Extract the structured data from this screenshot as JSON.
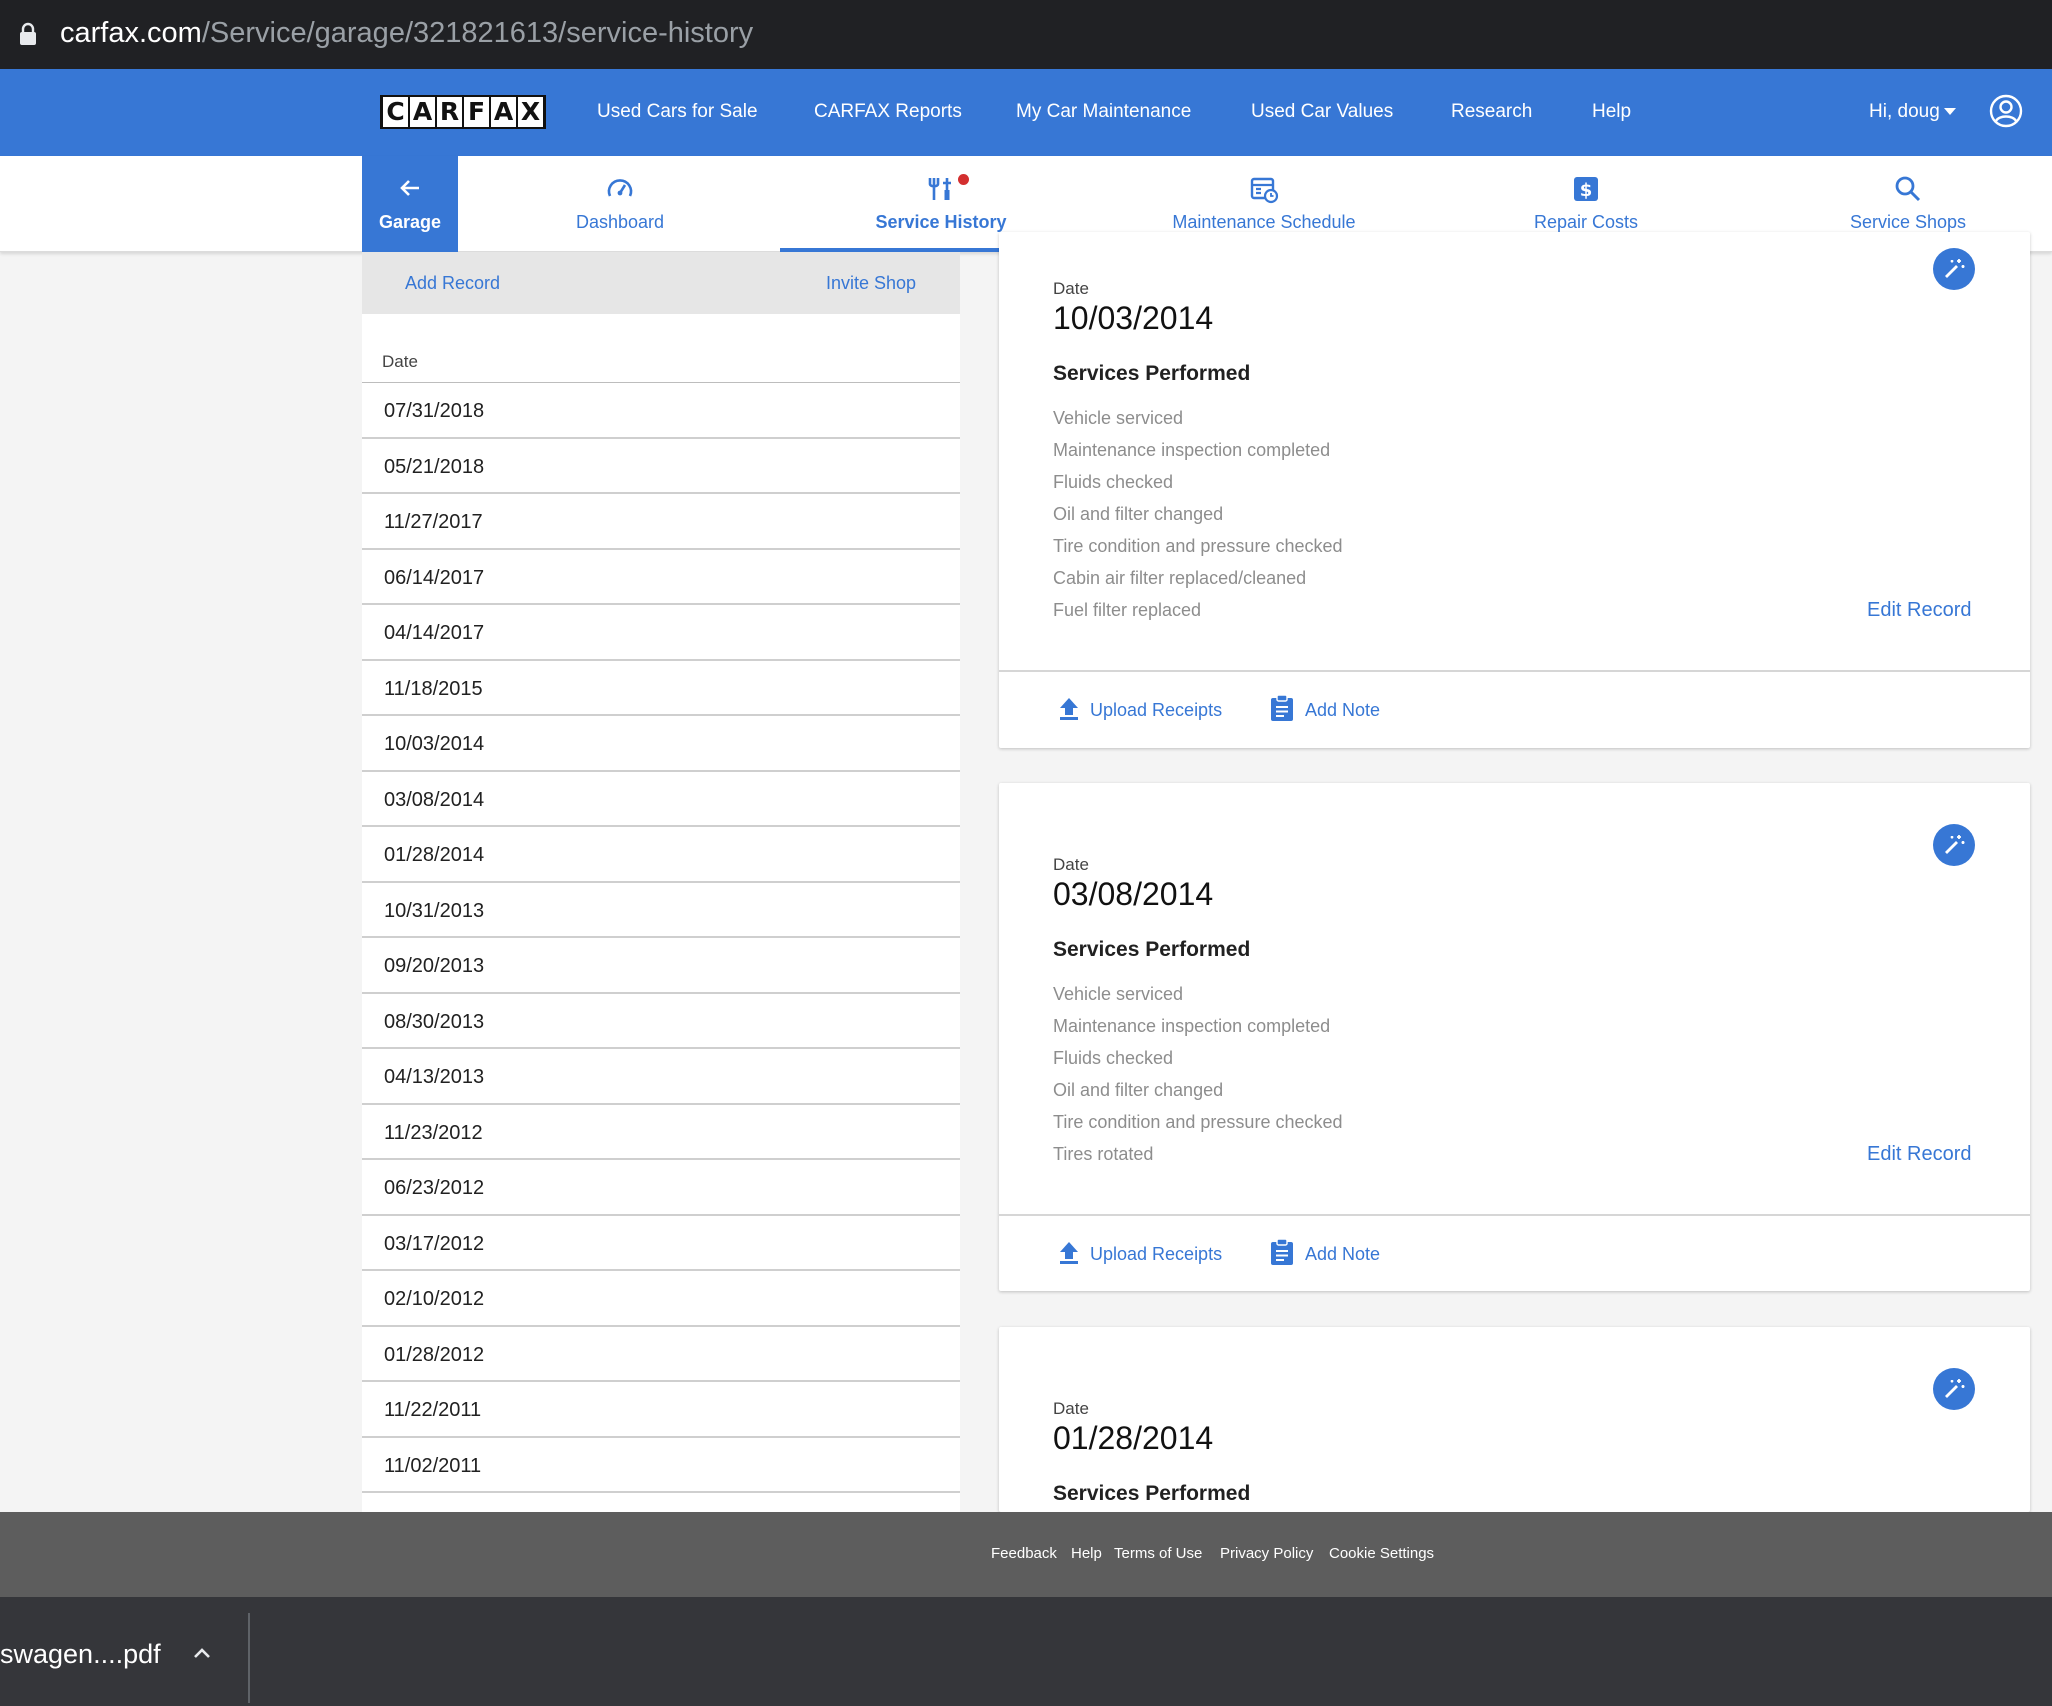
{
  "browser": {
    "url_host": "carfax.com",
    "url_path": "/Service/garage/321821613/service-history"
  },
  "topnav": {
    "logo_letters": [
      "C",
      "A",
      "R",
      "F",
      "A",
      "X"
    ],
    "links": [
      "Used Cars for Sale",
      "CARFAX Reports",
      "My Car Maintenance",
      "Used Car Values",
      "Research",
      "Help"
    ],
    "user_greeting": "Hi, doug"
  },
  "subnav": {
    "garage_label": "Garage",
    "tabs": [
      "Dashboard",
      "Service History",
      "Maintenance Schedule",
      "Repair Costs",
      "Service Shops"
    ],
    "active_tab": "Service History"
  },
  "list": {
    "add_record": "Add Record",
    "invite_shop": "Invite Shop",
    "date_header": "Date",
    "dates": [
      "07/31/2018",
      "05/21/2018",
      "11/27/2017",
      "06/14/2017",
      "04/14/2017",
      "11/18/2015",
      "10/03/2014",
      "03/08/2014",
      "01/28/2014",
      "10/31/2013",
      "09/20/2013",
      "08/30/2013",
      "04/13/2013",
      "11/23/2012",
      "06/23/2012",
      "03/17/2012",
      "02/10/2012",
      "01/28/2012",
      "11/22/2011",
      "11/02/2011"
    ]
  },
  "records": [
    {
      "date_label": "Date",
      "date": "10/03/2014",
      "services_title": "Services Performed",
      "services": [
        "Vehicle serviced",
        "Maintenance inspection completed",
        "Fluids checked",
        "Oil and filter changed",
        "Tire condition and pressure checked",
        "Cabin air filter replaced/cleaned",
        "Fuel filter replaced"
      ],
      "edit_label": "Edit Record",
      "upload_label": "Upload Receipts",
      "note_label": "Add Note"
    },
    {
      "date_label": "Date",
      "date": "03/08/2014",
      "services_title": "Services Performed",
      "services": [
        "Vehicle serviced",
        "Maintenance inspection completed",
        "Fluids checked",
        "Oil and filter changed",
        "Tire condition and pressure checked",
        "Tires rotated"
      ],
      "edit_label": "Edit Record",
      "upload_label": "Upload Receipts",
      "note_label": "Add Note"
    },
    {
      "date_label": "Date",
      "date": "01/28/2014",
      "services_title": "Services Performed"
    }
  ],
  "footer": {
    "links": [
      "Feedback",
      "Help",
      "Terms of Use",
      "Privacy Policy",
      "Cookie Settings"
    ]
  },
  "download": {
    "file_name": "swagen....pdf"
  },
  "colors": {
    "brand_blue": "#3777d5",
    "footer_gray": "#5d5d5d",
    "notification_red": "#d32f2f"
  },
  "icons": [
    "lock-icon",
    "arrow-left-icon",
    "speedometer-icon",
    "tools-icon",
    "calendar-clock-icon",
    "dollar-icon",
    "search-icon",
    "magic-wand-icon",
    "upload-icon",
    "clipboard-icon",
    "user-circle-icon",
    "chevron-up-icon"
  ]
}
